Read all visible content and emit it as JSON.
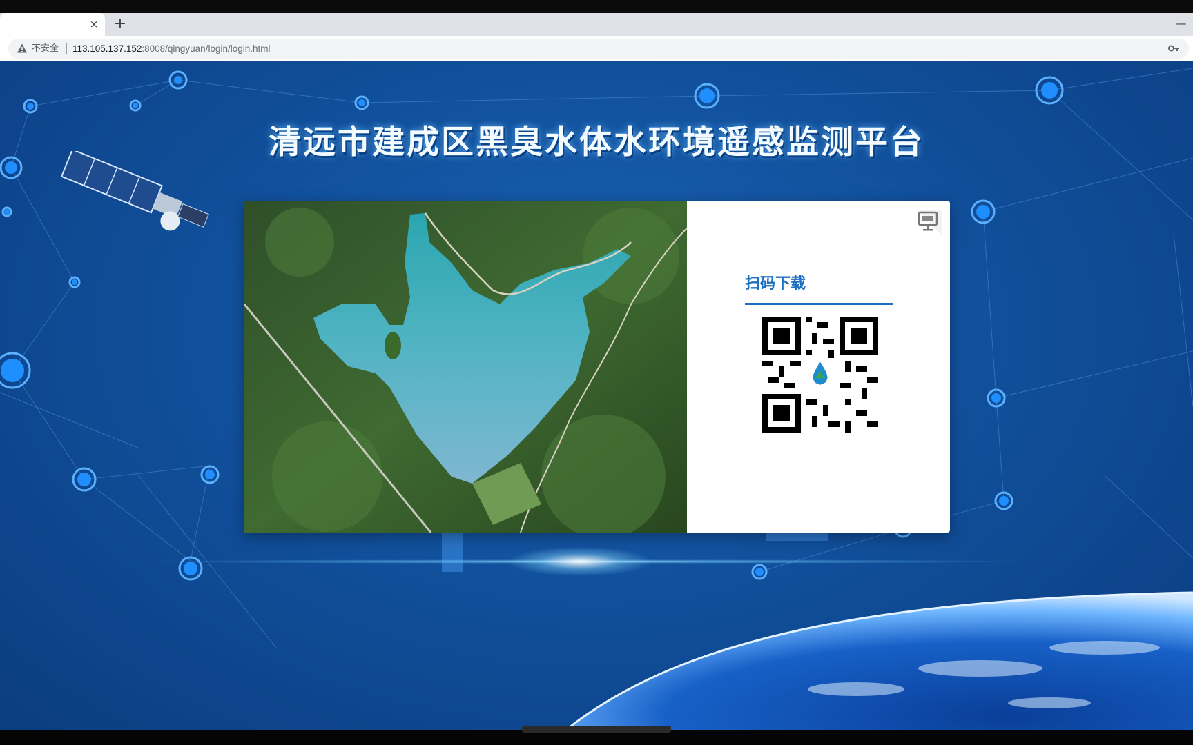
{
  "browser": {
    "tab": {
      "close_glyph": "×"
    },
    "new_tab_glyph": "+",
    "window_minimize_glyph": "—",
    "address_bar": {
      "security_label": "不安全",
      "url_host": "113.105.137.152",
      "url_rest": ":8008/qingyuan/login/login.html",
      "warning_icon": "warning-triangle-icon",
      "key_icon": "key-icon"
    }
  },
  "page": {
    "title": "清远市建成区黑臭水体水环境遥感监测平台",
    "login_panel": {
      "scan_heading": "扫码下载",
      "switch_icon": "monitor-switch-icon",
      "qr_icon": "qr-code-icon"
    }
  },
  "colors": {
    "background_blue": "#11509c",
    "accent_blue": "#1d6fc2",
    "panel_white": "#ffffff"
  }
}
